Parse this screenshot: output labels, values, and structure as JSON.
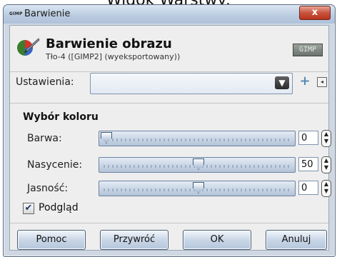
{
  "caption": "Widok Warstwy:",
  "window": {
    "app_badge": "GIMP",
    "title": "Barwienie",
    "close_label": "x"
  },
  "header": {
    "title": "Barwienie obrazu",
    "subtitle": "Tło-4 ([GIMP2] (wyeksportowany))",
    "thumb_label": "GIMP"
  },
  "settings": {
    "label": "Ustawienia:",
    "value": "",
    "arrow": "▼",
    "add_icon": "plus-icon",
    "collapse_icon": "collapse-panel-icon"
  },
  "color_section": {
    "title": "Wybór koloru",
    "rows": [
      {
        "label": "Barwa:",
        "value": "0",
        "level": 0.0
      },
      {
        "label": "Nasycenie:",
        "value": "50",
        "level": 0.5
      },
      {
        "label": "Jasność:",
        "value": "0",
        "level": 0.5
      }
    ]
  },
  "preview": {
    "label": "Podgląd",
    "checked": true
  },
  "buttons": {
    "help": "Pomoc",
    "reset": "Przywróć",
    "ok": "OK",
    "cancel": "Anuluj"
  },
  "colors": {
    "window_frame": "#cfd8e2",
    "dialog_bg": "#eeeeee",
    "close_red": "#c8553f",
    "accent_blue": "#5a89b8"
  }
}
